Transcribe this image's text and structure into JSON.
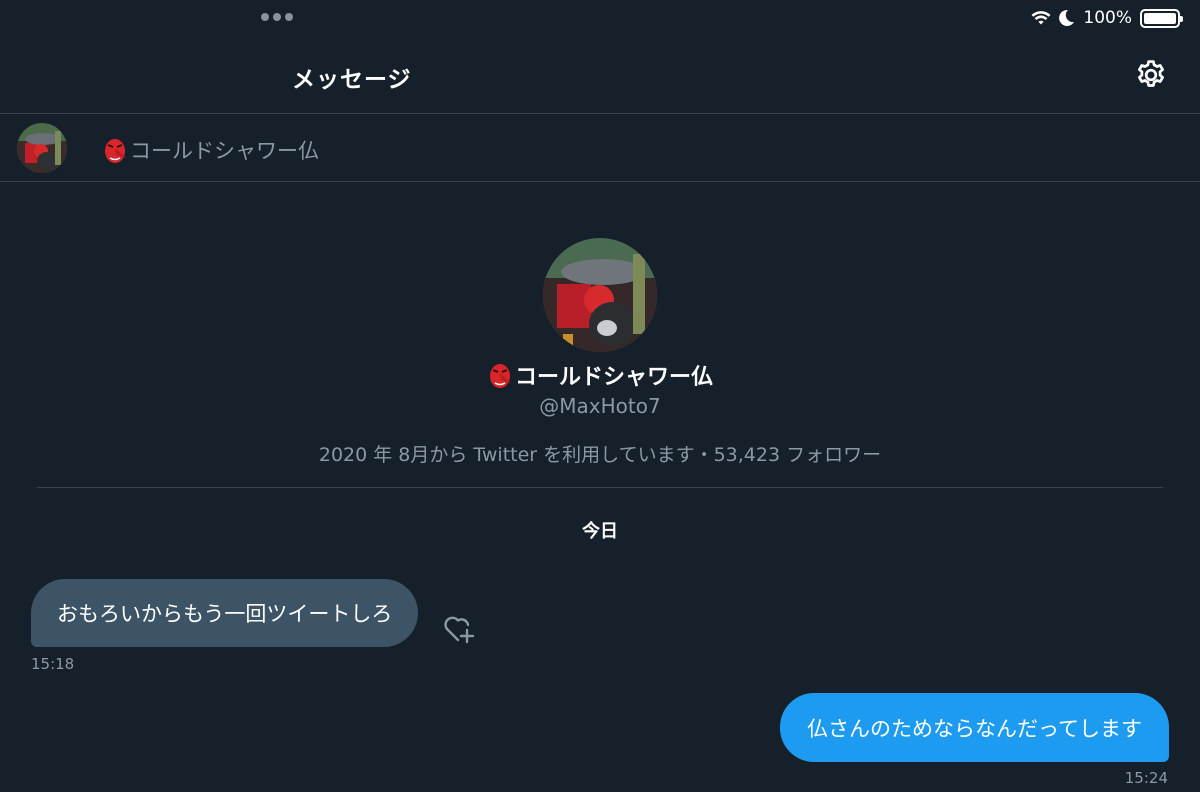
{
  "status_bar": {
    "battery_pct": "100%",
    "icons": [
      "more-dots-icon",
      "wifi-icon",
      "moon-icon",
      "battery-icon"
    ]
  },
  "header": {
    "title": "メッセージ",
    "settings_icon": "gear-icon"
  },
  "conversation": {
    "name": "コールドシャワー仏",
    "name_emoji": "tengu-mask-emoji"
  },
  "profile": {
    "name": "コールドシャワー仏",
    "handle": "@MaxHoto7",
    "meta": "2020 年 8月から Twitter を利用しています・53,423 フォロワー"
  },
  "date_separator": "今日",
  "messages": [
    {
      "direction": "incoming",
      "text": "おもろいからもう一回ツイートしろ",
      "time": "15:18"
    },
    {
      "direction": "outgoing",
      "text": "仏さんのためならなんだってします",
      "time": "15:24"
    }
  ],
  "colors": {
    "background": "#15202b",
    "incoming_bubble": "#3d5466",
    "outgoing_bubble": "#1d9bf0",
    "muted_text": "#8b98a5",
    "divider": "#38444d"
  }
}
